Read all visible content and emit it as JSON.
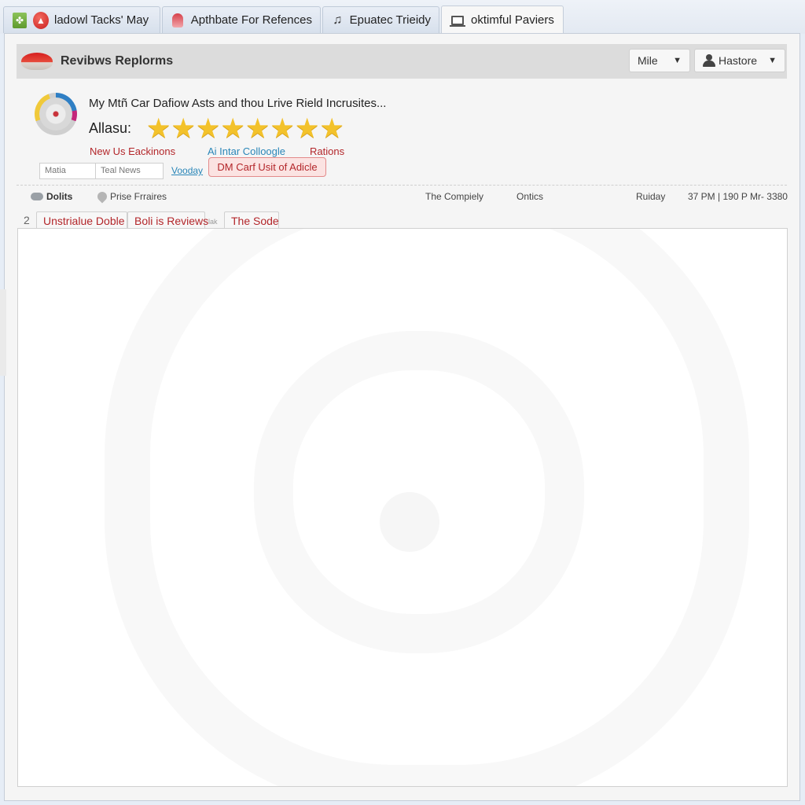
{
  "tabs": [
    {
      "label": "ladowl Tacks' May",
      "icon": "red-circle-icon",
      "active": false
    },
    {
      "label": "Apthbate For Refences",
      "icon": "jellyfish-icon",
      "active": false
    },
    {
      "label": "Epuatec Trieidy",
      "icon": "music-icon",
      "active": false
    },
    {
      "label": "oktimful Paviers",
      "icon": "laptop-icon",
      "active": true
    }
  ],
  "header": {
    "title": "Revibws Replorms",
    "dropdown_1": "Mile",
    "dropdown_2": "Hastore"
  },
  "item": {
    "title": "My Mtñ Car Dafiow Asts and thou Lrive Rield Incrusites...",
    "rating_label": "Allasu:",
    "rating": 8,
    "rating_max": 8,
    "links": {
      "red_1": "New Us Eackinons",
      "blue_1": "Ai Intar Colloogle",
      "red_2": "Rations"
    },
    "field_1_value": "Matia",
    "field_2_value": "Teal News",
    "link_underlined": "Vooday",
    "alert_button": "DM Carf Usit of Adicle"
  },
  "info_row": {
    "item_1": "Dolits",
    "item_2": "Prise Frraires",
    "item_3": "The Compiely",
    "item_4": "Ontics",
    "item_5": "Ruiday",
    "item_6": "37 PM | 190 P Mr- 3380"
  },
  "subtabs": {
    "number": "2",
    "items": [
      "Unstrialue Doble",
      "Boli is Reviews",
      "The Sode"
    ],
    "separator": "lak"
  },
  "colors": {
    "accent_red": "#b3262a",
    "link_blue": "#2a86b8",
    "star_gold": "#f3c22b"
  }
}
